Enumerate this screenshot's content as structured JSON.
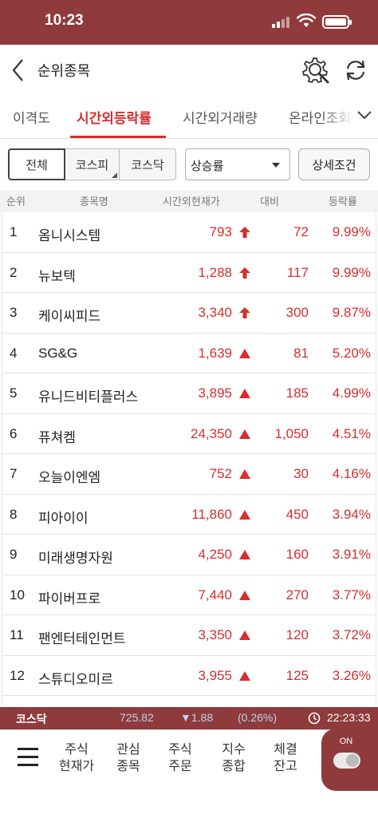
{
  "status_bar": {
    "time": "10:23"
  },
  "header": {
    "title": "순위종목"
  },
  "tabs": [
    {
      "label": "이격도",
      "active": false
    },
    {
      "label": "시간외등락률",
      "active": true
    },
    {
      "label": "시간외거래량",
      "active": false
    },
    {
      "label": "온라인조회",
      "active": false
    }
  ],
  "filters": {
    "market_all": "전체",
    "market_kospi": "코스피",
    "market_kosdaq": "코스닥",
    "sort_selected": "상승률",
    "detail_button": "상세조건"
  },
  "columns": {
    "rank": "순위",
    "name": "종목명",
    "price": "시간외현재가",
    "diff": "대비",
    "rate": "등락률"
  },
  "rows": [
    {
      "rank": "1",
      "name": "옴니시스템",
      "price": "793",
      "arrow": "upper-limit",
      "diff": "72",
      "rate": "9.99%"
    },
    {
      "rank": "2",
      "name": "뉴보텍",
      "price": "1,288",
      "arrow": "upper-limit",
      "diff": "117",
      "rate": "9.99%"
    },
    {
      "rank": "3",
      "name": "케이씨피드",
      "price": "3,340",
      "arrow": "upper-limit",
      "diff": "300",
      "rate": "9.87%"
    },
    {
      "rank": "4",
      "name": "SG&G",
      "price": "1,639",
      "arrow": "up",
      "diff": "81",
      "rate": "5.20%"
    },
    {
      "rank": "5",
      "name": "유니드비티플러스",
      "price": "3,895",
      "arrow": "up",
      "diff": "185",
      "rate": "4.99%"
    },
    {
      "rank": "6",
      "name": "퓨쳐켐",
      "price": "24,350",
      "arrow": "up",
      "diff": "1,050",
      "rate": "4.51%"
    },
    {
      "rank": "7",
      "name": "오늘이엔엠",
      "price": "752",
      "arrow": "up",
      "diff": "30",
      "rate": "4.16%"
    },
    {
      "rank": "8",
      "name": "피아이이",
      "price": "11,860",
      "arrow": "up",
      "diff": "450",
      "rate": "3.94%"
    },
    {
      "rank": "9",
      "name": "미래생명자원",
      "price": "4,250",
      "arrow": "up",
      "diff": "160",
      "rate": "3.91%"
    },
    {
      "rank": "10",
      "name": "파이버프로",
      "price": "7,440",
      "arrow": "up",
      "diff": "270",
      "rate": "3.77%"
    },
    {
      "rank": "11",
      "name": "팬엔터테인먼트",
      "price": "3,350",
      "arrow": "up",
      "diff": "120",
      "rate": "3.72%"
    },
    {
      "rank": "12",
      "name": "스튜디오미르",
      "price": "3,955",
      "arrow": "up",
      "diff": "125",
      "rate": "3.26%"
    }
  ],
  "ticker": {
    "index_name": "코스닥",
    "value": "725.82",
    "change": "▼1.88",
    "rate": "(0.26%)",
    "time": "22:23:33"
  },
  "bottom_nav": {
    "items": [
      {
        "line1": "주식",
        "line2": "현재가"
      },
      {
        "line1": "관심",
        "line2": "종목"
      },
      {
        "line1": "주식",
        "line2": "주문"
      },
      {
        "line1": "지수",
        "line2": "종합"
      },
      {
        "line1": "체결",
        "line2": "잔고"
      }
    ],
    "toggle_label": "ON"
  },
  "colors": {
    "brand": "#8f3b3b",
    "up_red": "#d62e2e",
    "down_blue": "#bcd0f5"
  },
  "icons": {
    "back": "chevron-left-icon",
    "search_settings": "gear-search-icon",
    "refresh": "refresh-icon",
    "upper_limit": "bold-up-arrow-icon",
    "up": "up-triangle-icon",
    "clock": "clock-icon",
    "menu": "hamburger-icon"
  }
}
